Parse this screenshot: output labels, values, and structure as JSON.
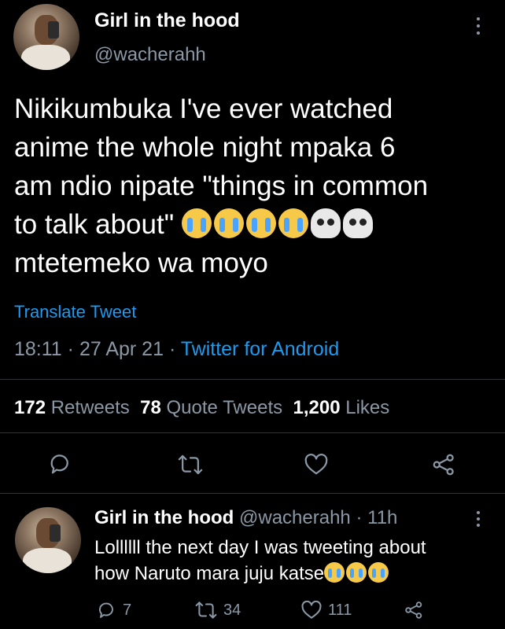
{
  "tweet": {
    "display_name": "Girl in the hood",
    "handle": "@wacherahh",
    "text_line1": "Nikikumbuka I've ever watched",
    "text_line2": "anime the whole night mpaka 6",
    "text_line3": "am ndio nipate \"things in common",
    "text_line4": "to talk about\"",
    "text_line5": "mtetemeko wa moyo",
    "emojis": [
      "loudly-crying-face",
      "loudly-crying-face",
      "loudly-crying-face",
      "loudly-crying-face",
      "skull",
      "skull"
    ],
    "translate": "Translate Tweet",
    "time": "18:11",
    "date": "27 Apr 21",
    "source": "Twitter for Android",
    "separator": "·"
  },
  "stats": {
    "retweets_count": "172",
    "retweets_label": "Retweets",
    "quotes_count": "78",
    "quotes_label": "Quote Tweets",
    "likes_count": "1,200",
    "likes_label": "Likes"
  },
  "actions": [
    "reply-icon",
    "retweet-icon",
    "like-icon",
    "share-icon"
  ],
  "reply": {
    "display_name": "Girl in the hood",
    "handle": "@wacherahh",
    "age": "11h",
    "separator": "·",
    "text_line1": "Lollllll the next day I was tweeting about",
    "text_line2": "how Naruto mara juju katse",
    "emojis": [
      "loudly-crying-face",
      "loudly-crying-face",
      "loudly-crying-face"
    ],
    "reply_count": "7",
    "retweet_count": "34",
    "like_count": "111"
  },
  "colors": {
    "background": "#000000",
    "link": "#1d9bf0",
    "muted": "#8b98a5",
    "divider": "#2f3336"
  }
}
